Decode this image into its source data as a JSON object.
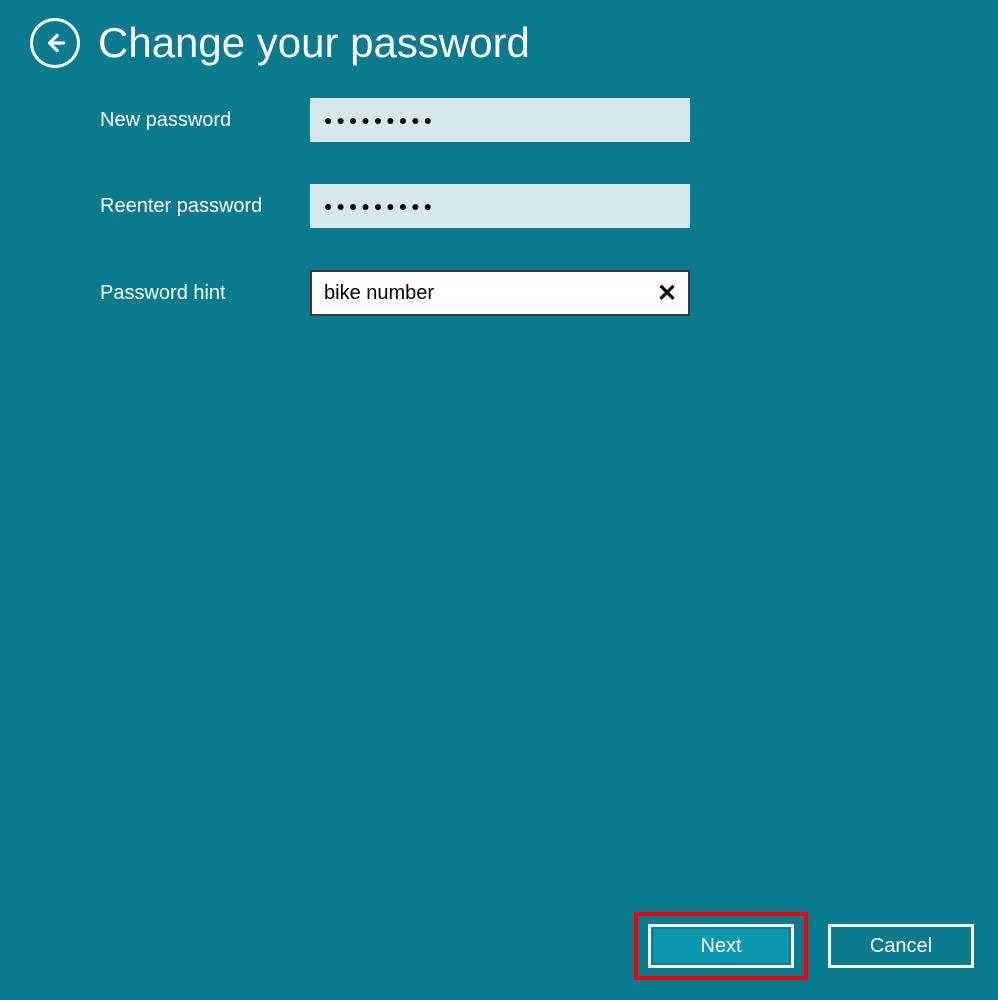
{
  "header": {
    "title": "Change your password"
  },
  "form": {
    "new_password": {
      "label": "New password",
      "value_mask": "●●●●●●●●●"
    },
    "reenter_password": {
      "label": "Reenter password",
      "value_mask": "●●●●●●●●●"
    },
    "password_hint": {
      "label": "Password hint",
      "value": "bike number"
    }
  },
  "footer": {
    "next_label": "Next",
    "cancel_label": "Cancel"
  },
  "colors": {
    "background": "#0a7a8f",
    "accent": "#0b97b0",
    "highlight": "#ff0000"
  }
}
